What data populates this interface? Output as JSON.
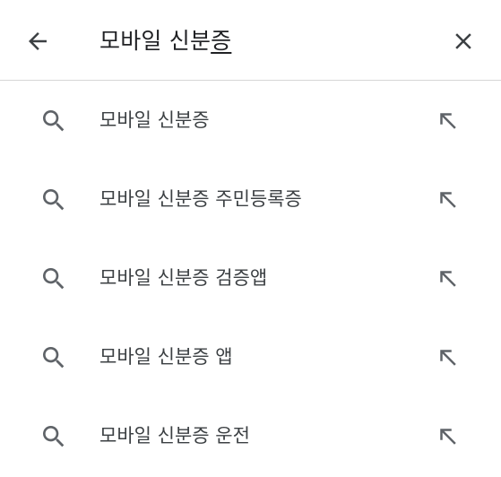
{
  "search": {
    "query_prefix": "모바일 신분",
    "query_composing": "증"
  },
  "suggestions": [
    {
      "label": "모바일 신분증"
    },
    {
      "label": "모바일 신분증 주민등록증"
    },
    {
      "label": "모바일 신분증 검증앱"
    },
    {
      "label": "모바일 신분증 앱"
    },
    {
      "label": "모바일 신분증 운전"
    }
  ],
  "icons": {
    "back": "arrow-back-icon",
    "clear": "close-icon",
    "suggestion": "search-icon",
    "fill": "arrow-north-west-icon"
  },
  "colors": {
    "icon_dark": "#3c4043",
    "icon_grey": "#5f6368",
    "divider": "#d6d6d6"
  }
}
